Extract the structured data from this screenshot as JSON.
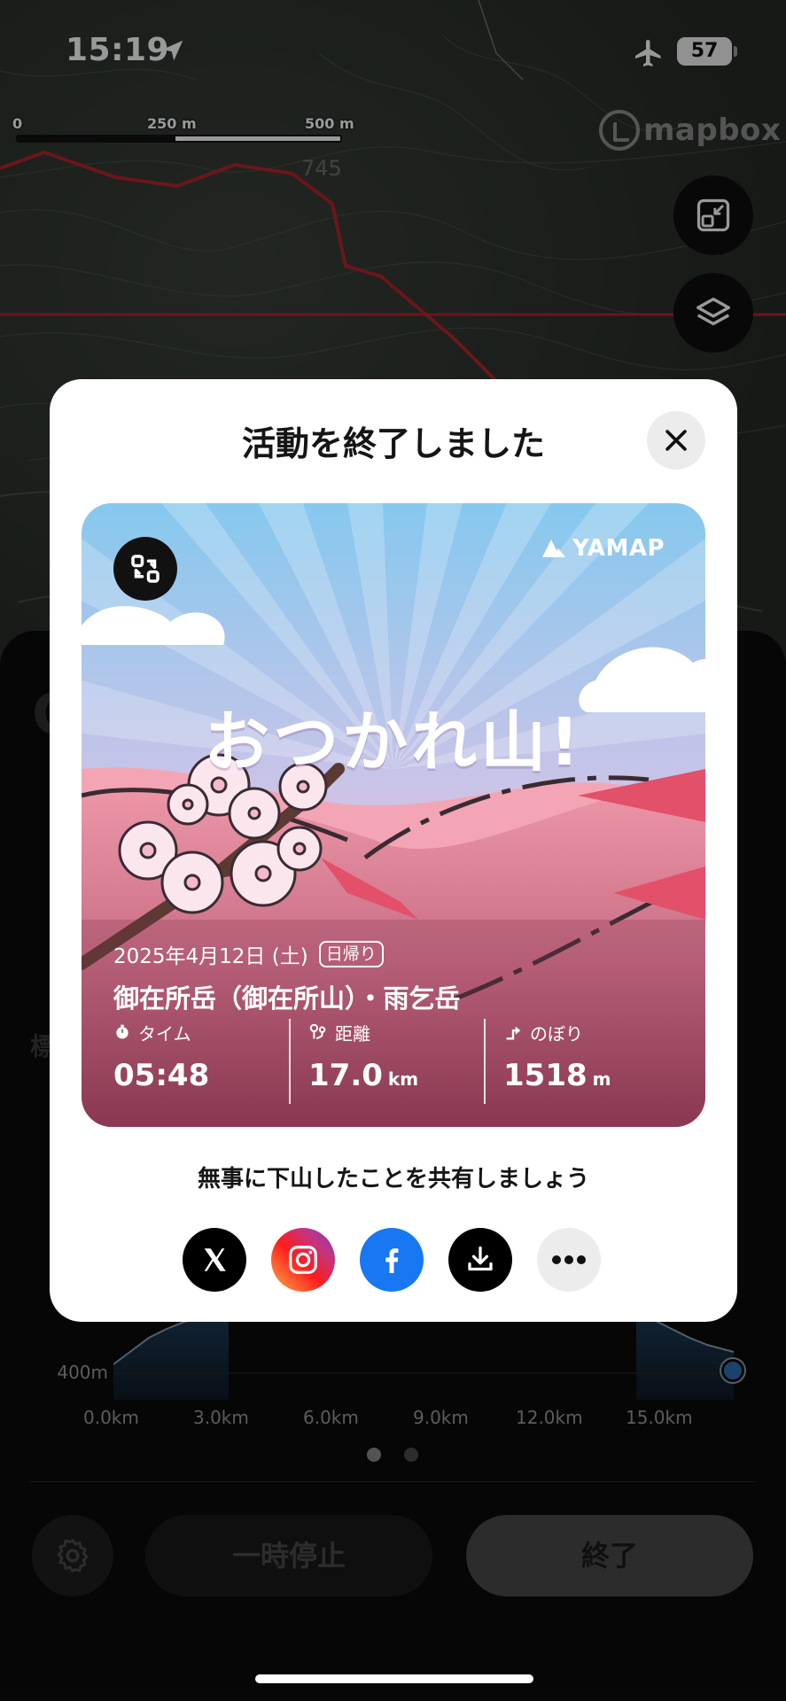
{
  "status_bar": {
    "time": "15:19",
    "battery": "57"
  },
  "map": {
    "scale_labels": [
      "0",
      "250 m",
      "500 m"
    ],
    "contour_label": "745",
    "attribution": "mapbox"
  },
  "modal": {
    "title": "活動を終了しました",
    "card": {
      "brand": "YAMAP",
      "headline": "おつかれ山!",
      "date": "2025年4月12日 (土)",
      "trip_type": "日帰り",
      "peaks": "御在所岳（御在所山）・雨乞岳",
      "stats": [
        {
          "label": "タイム",
          "value": "05:48",
          "unit": ""
        },
        {
          "label": "距離",
          "value": "17.0",
          "unit": "km"
        },
        {
          "label": "のぼり",
          "value": "1518",
          "unit": "m"
        }
      ]
    },
    "share_prompt": "無事に下山したことを共有しましょう"
  },
  "elevation_chart": {
    "y_labels": [
      "400m"
    ],
    "x_labels": [
      "0.0km",
      "3.0km",
      "6.0km",
      "9.0km",
      "12.0km",
      "15.0km"
    ]
  },
  "controls": {
    "pause_label": "一時停止",
    "end_label": "終了"
  },
  "colors": {
    "route": "#b3262d",
    "accent_blue": "#2d6fb5",
    "facebook": "#1877f2"
  }
}
